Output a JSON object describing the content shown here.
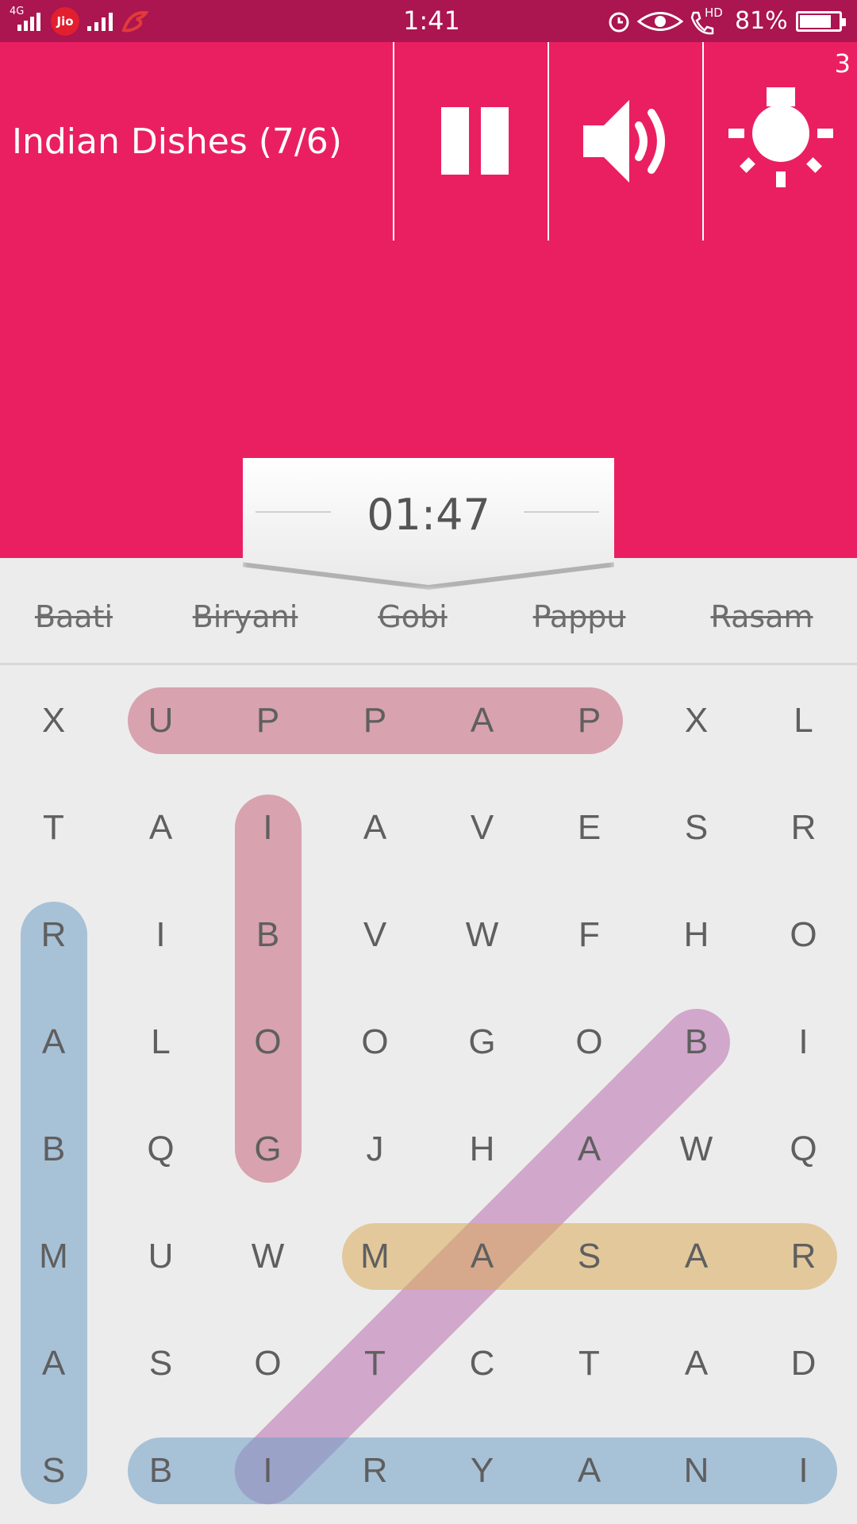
{
  "status_bar": {
    "network_label": "4G",
    "carrier_badge": "Jio",
    "time": "1:41",
    "hd_label": "HD",
    "battery_percent": "81%",
    "battery_level": 0.81
  },
  "header": {
    "level_title": "Indian Dishes (7/6)",
    "hint_count": "3",
    "pause_icon": "pause-icon",
    "sound_icon": "speaker-icon",
    "hint_icon": "lightbulb-icon",
    "bg_color": "#ea1f62"
  },
  "timer": {
    "value": "01:47"
  },
  "words": [
    {
      "label": "Baati",
      "found": true
    },
    {
      "label": "Biryani",
      "found": true
    },
    {
      "label": "Gobi",
      "found": true
    },
    {
      "label": "Pappu",
      "found": true
    },
    {
      "label": "Rasam",
      "found": true
    }
  ],
  "grid": {
    "rows": [
      [
        "X",
        "U",
        "P",
        "P",
        "A",
        "P",
        "X",
        "L"
      ],
      [
        "T",
        "A",
        "I",
        "A",
        "V",
        "E",
        "S",
        "R"
      ],
      [
        "R",
        "I",
        "B",
        "V",
        "W",
        "F",
        "H",
        "O"
      ],
      [
        "A",
        "L",
        "O",
        "O",
        "G",
        "O",
        "B",
        "I"
      ],
      [
        "B",
        "Q",
        "G",
        "J",
        "H",
        "A",
        "W",
        "Q"
      ],
      [
        "M",
        "U",
        "W",
        "M",
        "A",
        "S",
        "A",
        "R"
      ],
      [
        "A",
        "S",
        "O",
        "T",
        "C",
        "T",
        "A",
        "D"
      ],
      [
        "S",
        "B",
        "I",
        "R",
        "Y",
        "A",
        "N",
        "I"
      ]
    ],
    "highlights": [
      {
        "word": "PAPPU",
        "from": [
          0,
          5
        ],
        "to": [
          0,
          1
        ],
        "color": "#c9667e"
      },
      {
        "word": "GOBI",
        "from": [
          4,
          2
        ],
        "to": [
          1,
          2
        ],
        "color": "#c9667e"
      },
      {
        "word": "BAATI",
        "from": [
          3,
          6
        ],
        "to": [
          7,
          2
        ],
        "color": "#bb6fb0"
      },
      {
        "word": "RASAM",
        "from": [
          5,
          7
        ],
        "to": [
          5,
          3
        ],
        "color": "#dbab5a"
      },
      {
        "word": "SAMBAR",
        "from": [
          7,
          0
        ],
        "to": [
          2,
          0
        ],
        "color": "#6f9fc6"
      },
      {
        "word": "BIRYANI",
        "from": [
          7,
          1
        ],
        "to": [
          7,
          7
        ],
        "color": "#6f9fc6"
      }
    ]
  }
}
